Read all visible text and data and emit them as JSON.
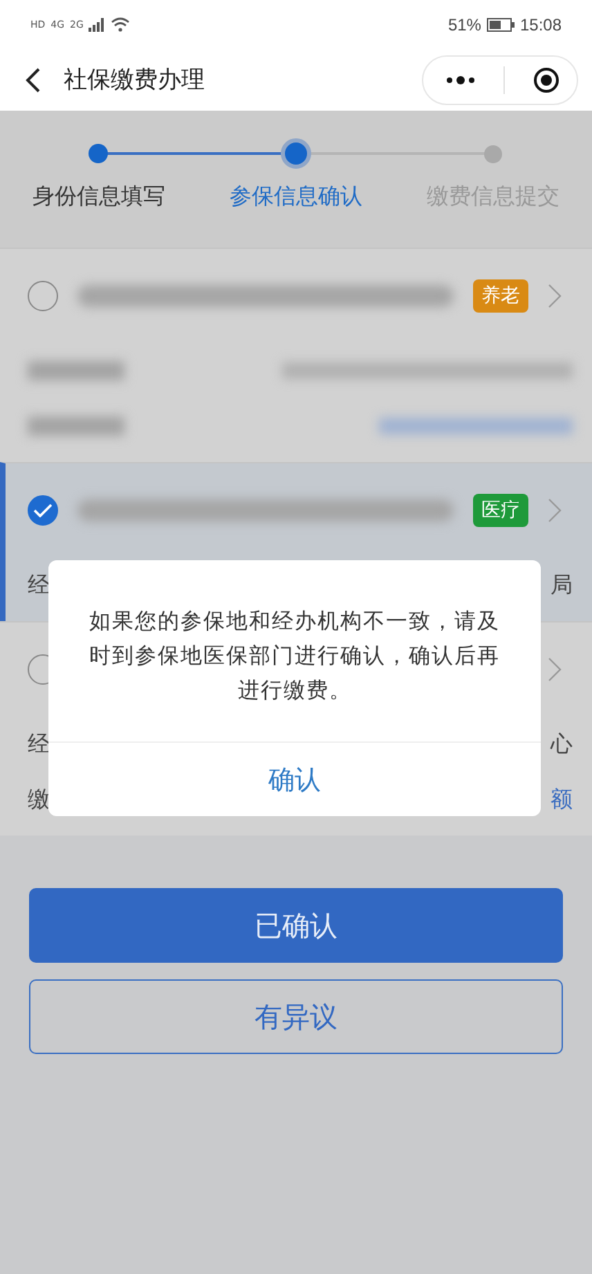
{
  "status_bar": {
    "network_labels": [
      "HD",
      "4G",
      "2G"
    ],
    "battery": "51%",
    "time": "15:08"
  },
  "nav": {
    "title": "社保缴费办理"
  },
  "steps": [
    {
      "label": "身份信息填写",
      "done": true,
      "selected": false
    },
    {
      "label": "参保信息确认",
      "done": false,
      "selected": true
    },
    {
      "label": "缴费信息提交",
      "done": false,
      "selected": false
    }
  ],
  "records": [
    {
      "checked": false,
      "selected": false,
      "tag": "养老",
      "color": "#d98a14",
      "details": [
        {
          "kind": "blurred"
        },
        {
          "kind": "blurred_link"
        }
      ]
    },
    {
      "checked": true,
      "selected": true,
      "tag": "医疗",
      "color": "#1e9a3a",
      "details": [
        {
          "kind": "text",
          "label": "经",
          "value": "局"
        }
      ]
    },
    {
      "checked": false,
      "selected": false,
      "details": [
        {
          "kind": "text",
          "label": "经",
          "value": "心"
        },
        {
          "kind": "text",
          "label": "缴",
          "value": "额"
        }
      ]
    }
  ],
  "buttons": [
    {
      "label": "已确认",
      "kind": "primary"
    },
    {
      "label": "有异议",
      "kind": "outline"
    }
  ],
  "dialog": {
    "message": "如果您的参保地和经办机构不一致，请及时到参保地医保部门进行确认，确认后再进行缴费。",
    "button": "确认"
  }
}
